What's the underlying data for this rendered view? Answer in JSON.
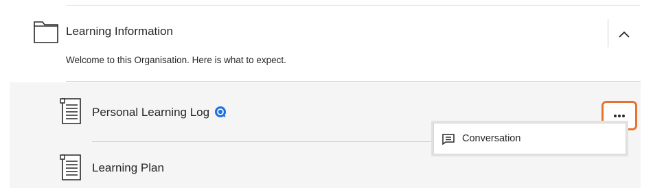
{
  "section": {
    "title": "Learning Information",
    "description": "Welcome to this Organisation. Here is what to expect.",
    "collapse_icon": "chevron-up-icon",
    "folder_icon": "folder-icon"
  },
  "items": [
    {
      "title": "Personal Learning Log",
      "icon": "document-icon",
      "has_conversation_indicator": true
    },
    {
      "title": "Learning Plan",
      "icon": "document-icon",
      "has_conversation_indicator": false
    }
  ],
  "more_options_icon": "more-options-icon",
  "dropdown": {
    "items": [
      {
        "label": "Conversation",
        "icon": "conversation-icon"
      }
    ]
  },
  "colors": {
    "highlight": "#e8742c",
    "indicator": "#1f6fe0",
    "panel_bg": "#f5f5f5",
    "text": "#262626"
  }
}
